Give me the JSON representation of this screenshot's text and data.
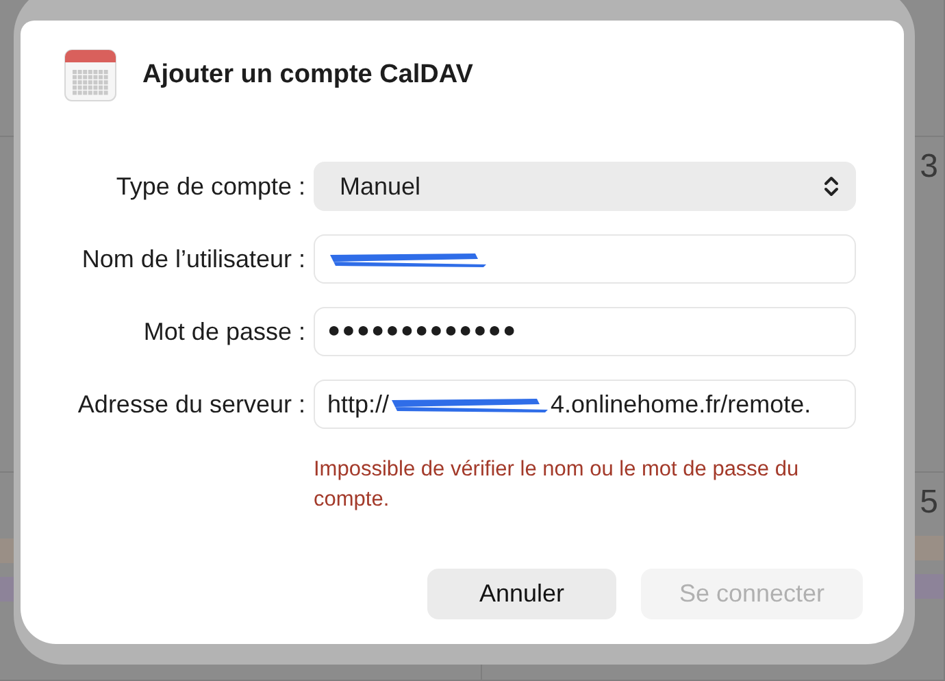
{
  "background": {
    "day_numbers": [
      "3",
      "5"
    ]
  },
  "dialog": {
    "title": "Ajouter un compte CalDAV",
    "fields": [
      {
        "kind": "select",
        "label": "Type de compte :",
        "value": "Manuel"
      },
      {
        "kind": "text",
        "label": "Nom de l’utilisateur :",
        "redacted": true
      },
      {
        "kind": "password",
        "label": "Mot de passe :",
        "value": "●●●●●●●●●●●●●"
      },
      {
        "kind": "text",
        "label": "Adresse du serveur :",
        "value": "http://",
        "value_after": "4.onlinehome.fr/remote.",
        "redacted": true
      }
    ],
    "error": "Impossible de vérifier le nom ou le mot de passe du compte.",
    "buttons": [
      {
        "label": "Annuler",
        "disabled": false
      },
      {
        "label": "Se connecter",
        "disabled": true
      }
    ]
  }
}
